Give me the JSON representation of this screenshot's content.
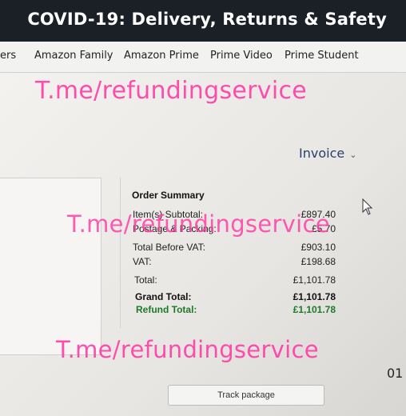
{
  "banner": {
    "title": "COVID-19: Delivery, Returns & Safety"
  },
  "nav": {
    "items": [
      {
        "label": "ers"
      },
      {
        "label": "Amazon Family"
      },
      {
        "label": "Amazon Prime"
      },
      {
        "label": "Prime Video"
      },
      {
        "label": "Prime Student"
      }
    ]
  },
  "invoice": {
    "label": "Invoice",
    "chevron": "⌄"
  },
  "order_summary": {
    "title": "Order Summary",
    "rows": [
      {
        "label": "Item(s) Subtotal:",
        "value": "£897.40"
      },
      {
        "label": "Postage & Packing:",
        "value": "£5.70"
      },
      {
        "label": "Total Before VAT:",
        "value": "£903.10"
      },
      {
        "label": "VAT:",
        "value": "£198.68"
      },
      {
        "label": "Total:",
        "value": "£1,101.78"
      },
      {
        "label": "Grand Total:",
        "value": "£1,101.78"
      },
      {
        "label": "Refund Total:",
        "value": "£1,101.78"
      }
    ]
  },
  "track_button": {
    "label": "Track package"
  },
  "edge_text": "01",
  "watermarks": [
    "T.me/refundingservice",
    "T.me/refundingservice",
    "T.me/refundingservice"
  ],
  "colors": {
    "banner": "#1b2027",
    "refund_green": "#1c7a26",
    "watermark_pink": "#ff3fa6"
  },
  "icons": {
    "cursor": "mouse-pointer-icon"
  }
}
